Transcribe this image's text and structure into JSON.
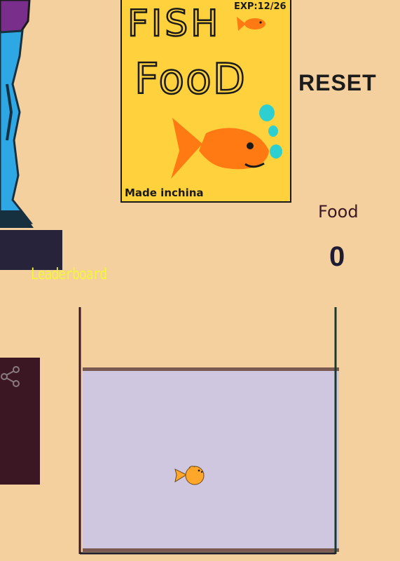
{
  "sidebar": {
    "leaderboard_label": "Leaderboard",
    "share_icon": "share-icon"
  },
  "food_box": {
    "title_line_1": "FISH",
    "title_line_2": "FooD",
    "expiry": "EXP:12/26",
    "footer": "Made inchina"
  },
  "controls": {
    "reset_label": "RESET",
    "food_label": "Food",
    "food_count": "0"
  },
  "tank": {
    "fish_icon": "goldfish-icon"
  },
  "colors": {
    "background": "#F4D09E",
    "box_yellow": "#FFD23D",
    "fish_orange": "#FF7A12",
    "water": "#CFC6DF",
    "leaderboard_text": "#F5F53A"
  }
}
